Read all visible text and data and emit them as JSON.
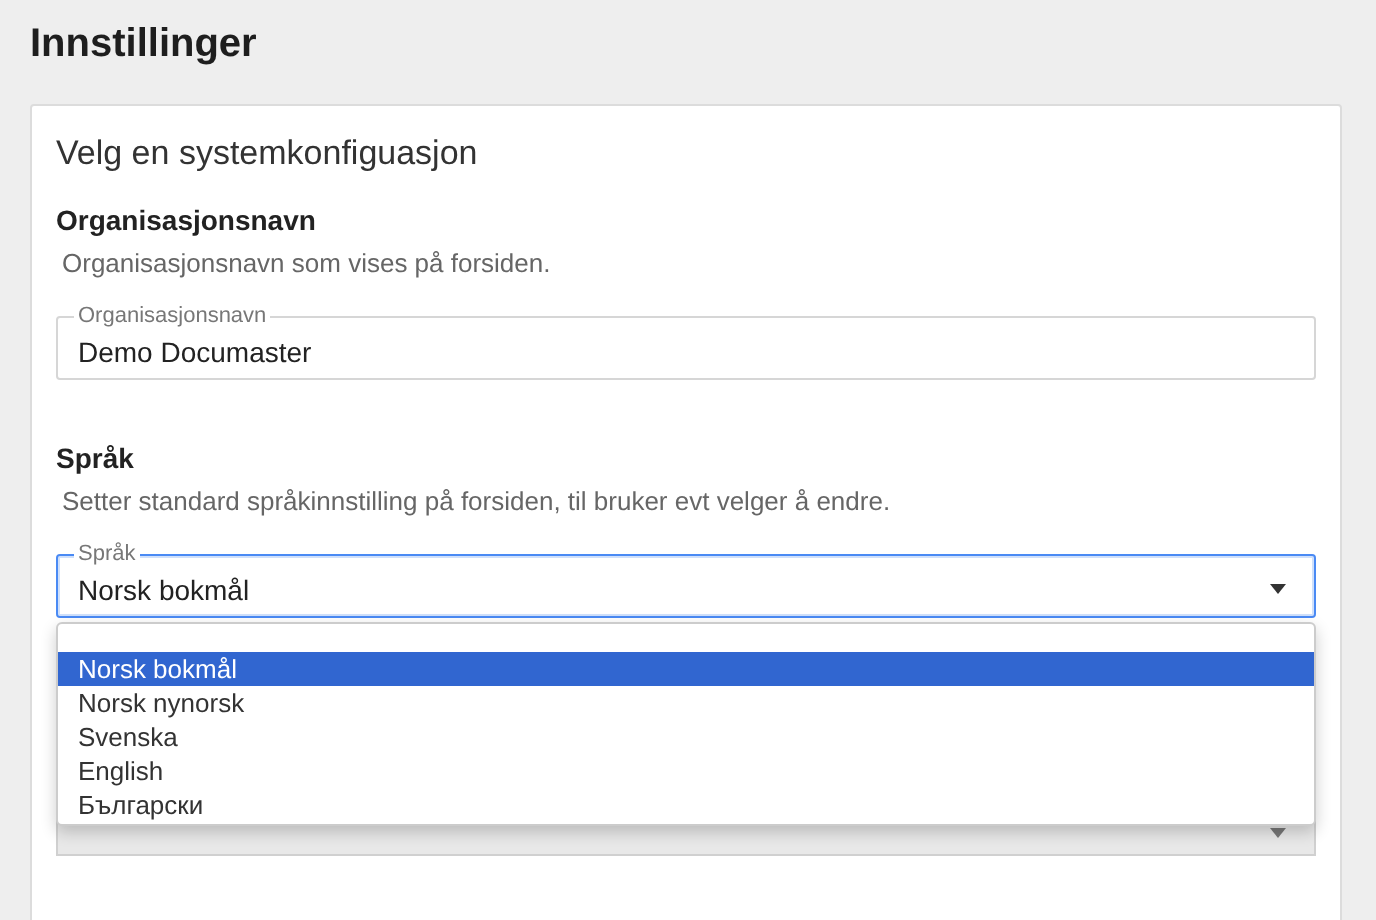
{
  "page_title": "Innstillinger",
  "card": {
    "title": "Velg en systemkonfiguasjon",
    "sections": [
      {
        "heading": "Organisasjonsnavn",
        "description": "Organisasjonsnavn som vises på forsiden.",
        "field": {
          "kind": "text",
          "label": "Organisasjonsnavn",
          "value": "Demo Documaster",
          "focused": false
        }
      },
      {
        "heading": "Språk",
        "description": "Setter standard språkinnstilling på forsiden, til bruker evt velger å endre.",
        "field": {
          "kind": "select",
          "label": "Språk",
          "value": "Norsk bokmål",
          "focused": true
        }
      }
    ],
    "dropdown": {
      "options": [
        {
          "label": "Norsk bokmål",
          "selected": true
        },
        {
          "label": "Norsk nynorsk",
          "selected": false
        },
        {
          "label": "Svenska",
          "selected": false
        },
        {
          "label": "English",
          "selected": false
        },
        {
          "label": "Български",
          "selected": false
        }
      ]
    },
    "covered_field": {
      "kind": "select"
    }
  }
}
